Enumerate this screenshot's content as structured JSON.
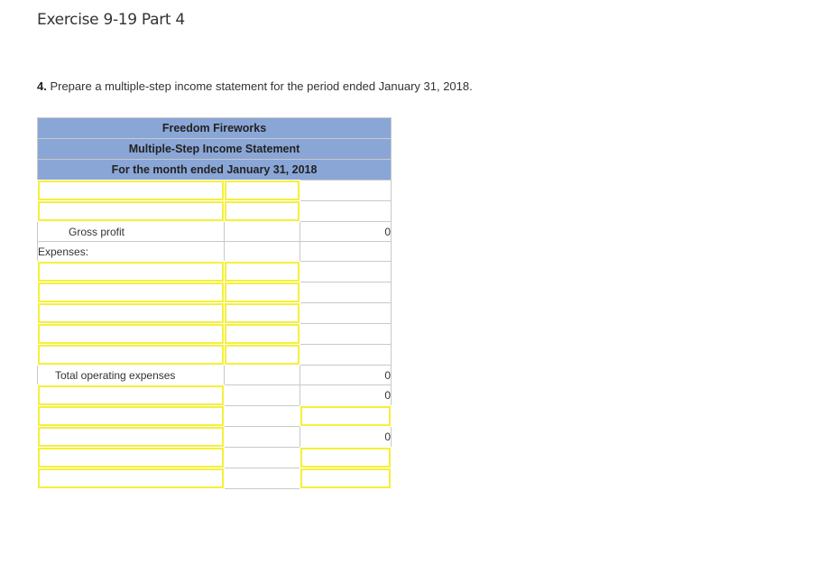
{
  "page": {
    "title": "Exercise 9-19 Part 4",
    "instruction_number": "4.",
    "instruction_text": " Prepare a multiple-step income statement for the period ended January 31, 2018."
  },
  "statement": {
    "company": "Freedom Fireworks",
    "statement_name": "Multiple-Step Income Statement",
    "period": "For the month ended January 31, 2018",
    "colors": {
      "header_bg": "#8aa6d6",
      "input_border": "#f5f03a",
      "grid": "#c9c9c9"
    },
    "rows": [
      {
        "c1": {
          "type": "input",
          "value": ""
        },
        "c2": {
          "type": "input",
          "value": ""
        },
        "c3": {
          "type": "empty"
        }
      },
      {
        "c1": {
          "type": "input",
          "value": ""
        },
        "c2": {
          "type": "input",
          "value": ""
        },
        "c3": {
          "type": "empty"
        }
      },
      {
        "c1": {
          "type": "label",
          "text": "Gross profit"
        },
        "c2": {
          "type": "empty"
        },
        "c3": {
          "type": "value",
          "text": "0"
        }
      },
      {
        "c1": {
          "type": "label",
          "text": "Expenses:"
        },
        "c2": {
          "type": "empty"
        },
        "c3": {
          "type": "empty"
        }
      },
      {
        "c1": {
          "type": "input",
          "value": ""
        },
        "c2": {
          "type": "input",
          "value": ""
        },
        "c3": {
          "type": "empty"
        }
      },
      {
        "c1": {
          "type": "input",
          "value": ""
        },
        "c2": {
          "type": "input",
          "value": ""
        },
        "c3": {
          "type": "empty"
        }
      },
      {
        "c1": {
          "type": "input",
          "value": ""
        },
        "c2": {
          "type": "input",
          "value": ""
        },
        "c3": {
          "type": "empty"
        }
      },
      {
        "c1": {
          "type": "input",
          "value": ""
        },
        "c2": {
          "type": "input",
          "value": ""
        },
        "c3": {
          "type": "empty"
        }
      },
      {
        "c1": {
          "type": "input",
          "value": ""
        },
        "c2": {
          "type": "input",
          "value": ""
        },
        "c3": {
          "type": "empty"
        }
      },
      {
        "c1": {
          "type": "label",
          "text": "Total operating expenses"
        },
        "c2": {
          "type": "empty"
        },
        "c3": {
          "type": "value",
          "text": "0"
        }
      },
      {
        "c1": {
          "type": "input",
          "value": ""
        },
        "c2": {
          "type": "empty"
        },
        "c3": {
          "type": "value",
          "text": "0"
        }
      },
      {
        "c1": {
          "type": "input",
          "value": ""
        },
        "c2": {
          "type": "empty"
        },
        "c3": {
          "type": "input",
          "value": ""
        }
      },
      {
        "c1": {
          "type": "input",
          "value": ""
        },
        "c2": {
          "type": "empty"
        },
        "c3": {
          "type": "value",
          "text": "0"
        }
      },
      {
        "c1": {
          "type": "input",
          "value": ""
        },
        "c2": {
          "type": "empty"
        },
        "c3": {
          "type": "input",
          "value": ""
        }
      },
      {
        "c1": {
          "type": "input",
          "value": ""
        },
        "c2": {
          "type": "empty"
        },
        "c3": {
          "type": "input",
          "value": ""
        }
      }
    ]
  }
}
